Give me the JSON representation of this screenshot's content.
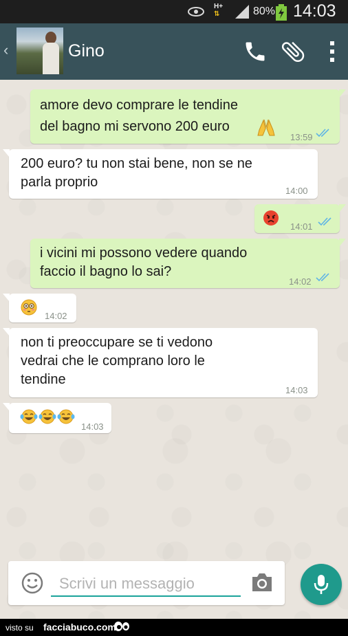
{
  "status_bar": {
    "network": "H+",
    "battery_percent": "80%",
    "time": "14:03"
  },
  "header": {
    "contact_name": "Gino",
    "icons": [
      "back-chevron-icon",
      "avatar",
      "phone-icon",
      "paperclip-icon",
      "overflow-menu-icon"
    ]
  },
  "messages": [
    {
      "direction": "out",
      "lines": [
        "amore devo comprare le tendine",
        "del bagno mi servono 200 euro"
      ],
      "emoji": "folded-hands",
      "time": "13:59",
      "ticks": "read"
    },
    {
      "direction": "in",
      "lines": [
        "200 euro? tu non stai bene, non se ne",
        "parla proprio"
      ],
      "time": "14:00"
    },
    {
      "direction": "out",
      "emoji": "angry-face",
      "time": "14:01",
      "ticks": "read"
    },
    {
      "direction": "out",
      "lines": [
        "i vicini mi possono vedere quando",
        "faccio il bagno lo sai?"
      ],
      "time": "14:02",
      "ticks": "read"
    },
    {
      "direction": "in",
      "emoji": "flushed-face",
      "time": "14:02"
    },
    {
      "direction": "in",
      "lines": [
        "non ti preoccupare se ti vedono",
        "vedrai che le comprano loro le",
        "tendine"
      ],
      "time": "14:03"
    },
    {
      "direction": "in",
      "emoji": "tears-of-joy x3",
      "time": "14:03"
    }
  ],
  "composer": {
    "placeholder": "Scrivi un messaggio"
  },
  "colors": {
    "app_bar": "#38525a",
    "outgoing_bubble": "#dbf5be",
    "incoming_bubble": "#ffffff",
    "read_ticks": "#5fb4e5",
    "mic_button": "#1f9a8c"
  },
  "footer": {
    "visto_su": "visto su",
    "brand": "facciabuco.com"
  }
}
